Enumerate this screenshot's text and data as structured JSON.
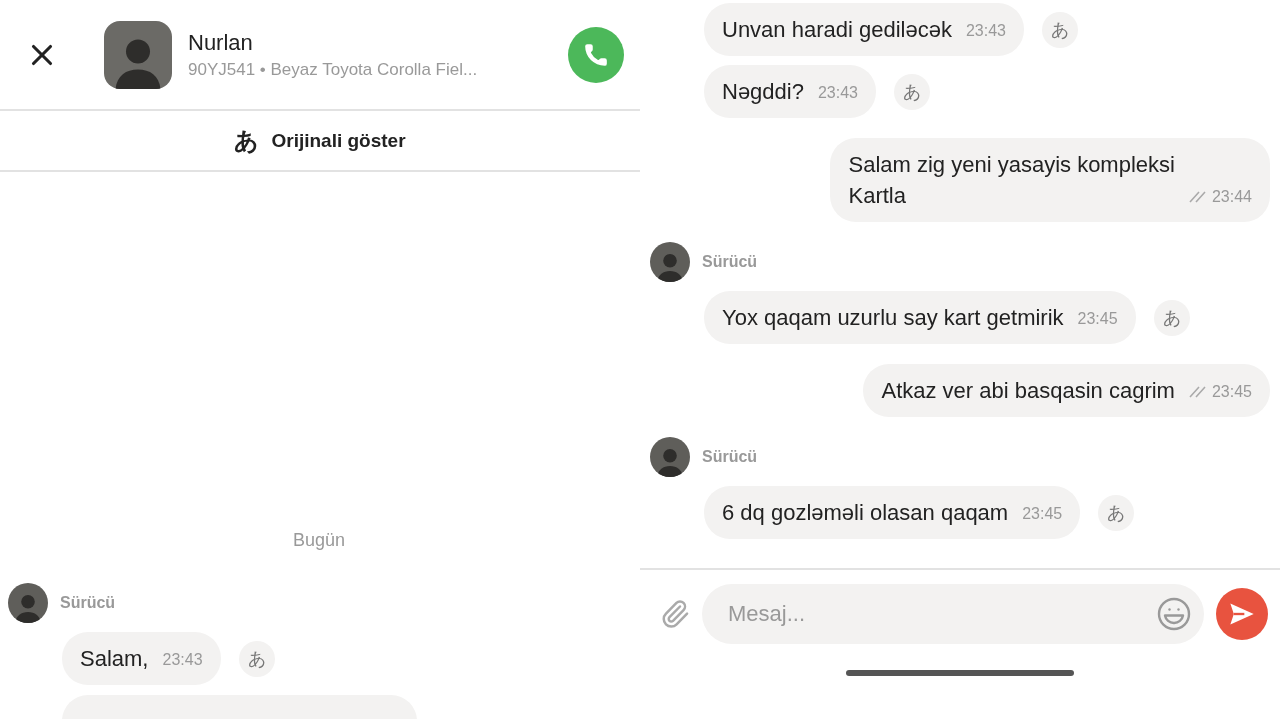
{
  "left": {
    "header": {
      "name": "Nurlan",
      "subtitle": "90YJ541 • Beyaz Toyota Corolla Fiel..."
    },
    "translate_bar": {
      "glyph": "あ",
      "label": "Orijinali göster"
    },
    "date_label": "Bugün",
    "groups": [
      {
        "kind": "incoming",
        "sender": "Sürücü",
        "bubbles": [
          {
            "text": "Salam,",
            "time": "23:43",
            "translate_glyph": "あ"
          }
        ]
      }
    ]
  },
  "right": {
    "groups": [
      {
        "kind": "incoming",
        "bubbles": [
          {
            "text": "Unvan haradi gediləcək",
            "time": "23:43",
            "translate_glyph": "あ"
          },
          {
            "text": "Nəgddi?",
            "time": "23:43",
            "translate_glyph": "あ"
          }
        ]
      },
      {
        "kind": "outgoing",
        "bubbles": [
          {
            "text": "Salam zig yeni yasayis kompleksi\nKartla",
            "time": "23:44"
          }
        ]
      },
      {
        "kind": "incoming",
        "sender": "Sürücü",
        "bubbles": [
          {
            "text": "Yox qaqam uzurlu say kart getmirik",
            "time": "23:45",
            "translate_glyph": "あ"
          }
        ]
      },
      {
        "kind": "outgoing",
        "bubbles": [
          {
            "text": "Atkaz ver abi basqasin cagrim",
            "time": "23:45"
          }
        ]
      },
      {
        "kind": "incoming",
        "sender": "Sürücü",
        "bubbles": [
          {
            "text": "6 dq gozləməli olasan qaqam",
            "time": "23:45",
            "translate_glyph": "あ"
          }
        ]
      }
    ],
    "composer": {
      "placeholder": "Mesaj..."
    }
  }
}
